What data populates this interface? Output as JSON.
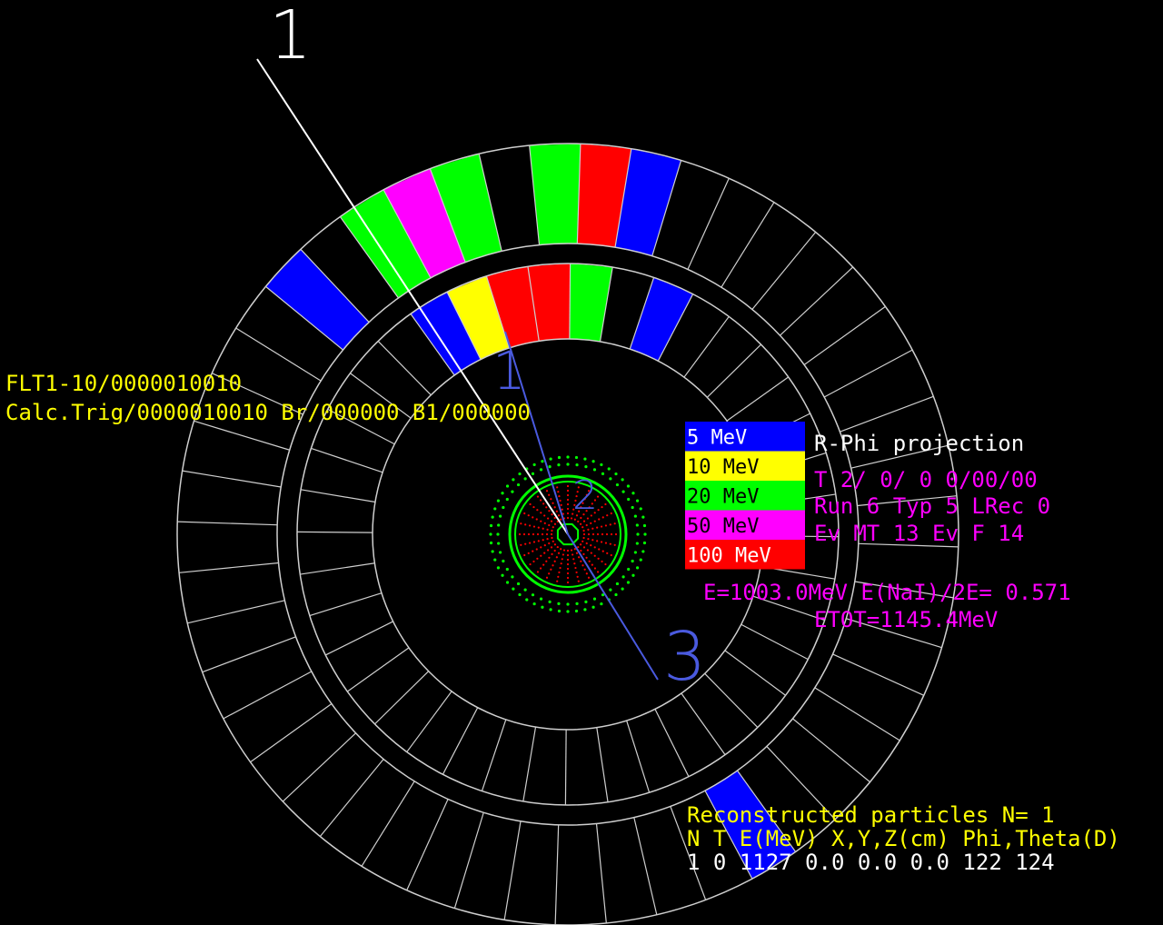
{
  "colors": {
    "background": "#000000",
    "grid": "#cfcfcf",
    "yellow_text": "#ffff00",
    "magenta_text": "#ff00ff",
    "white_text": "#ffffff",
    "track_blue": "#4a5adf",
    "track_white": "#ffffff",
    "vertex_green": "#00ff00",
    "vertex_red": "#ff0000"
  },
  "legend": {
    "items": [
      {
        "label": "5 MeV",
        "color": "#0000ff"
      },
      {
        "label": "10 MeV",
        "color": "#ffff00"
      },
      {
        "label": "20 MeV",
        "color": "#00ff00"
      },
      {
        "label": "50 MeV",
        "color": "#ff00ff"
      },
      {
        "label": "100 MeV",
        "color": "#ff0000"
      }
    ]
  },
  "header_left": {
    "line1": "FLT1-10/0000010010",
    "line2": "Calc.Trig/0000010010 Br/000000 B1/000000"
  },
  "projection": {
    "title": "R-Phi projection",
    "line1": "T  2/ 0/ 0  0/00/00",
    "line2": "Run  6  Typ  5  LRec   0",
    "line3": "Ev MT      13  Ev F   14"
  },
  "energy": {
    "line1": "E=1003.0MeV  E(NaI)/2E= 0.571",
    "line2": "ETOT=1145.4MeV"
  },
  "particles": {
    "title": "Reconstructed particles N= 1",
    "header": "N T E(MeV) X,Y,Z(cm) Phi,Theta(D)",
    "row": "1 0 1127  0.0  0.0  0.0 122 124"
  },
  "track_labels": {
    "t1": "1",
    "t2": "2",
    "t3": "3"
  },
  "detector": {
    "layers": [
      {
        "name": "outer",
        "segments": 48,
        "hits": [
          {
            "phi": 136.9,
            "color": "#0000ff"
          },
          {
            "phi": 121.9,
            "color": "#00ff00"
          },
          {
            "phi": 114.4,
            "color": "#ff00ff"
          },
          {
            "phi": 106.9,
            "color": "#00ff00"
          },
          {
            "phi": 91.9,
            "color": "#00ff00"
          },
          {
            "phi": 84.4,
            "color": "#ff0000"
          },
          {
            "phi": 76.9,
            "color": "#0000ff"
          },
          {
            "phi": -58.1,
            "color": "#0000ff"
          }
        ]
      },
      {
        "name": "inner",
        "segments": 40,
        "hits": [
          {
            "phi": 121.0,
            "color": "#0000ff"
          },
          {
            "phi": 112.0,
            "color": "#ffff00"
          },
          {
            "phi": 103.0,
            "color": "#ff0000"
          },
          {
            "phi": 94.0,
            "color": "#ff0000"
          },
          {
            "phi": 85.0,
            "color": "#00ff00"
          },
          {
            "phi": 67.0,
            "color": "#0000ff"
          }
        ]
      }
    ]
  }
}
